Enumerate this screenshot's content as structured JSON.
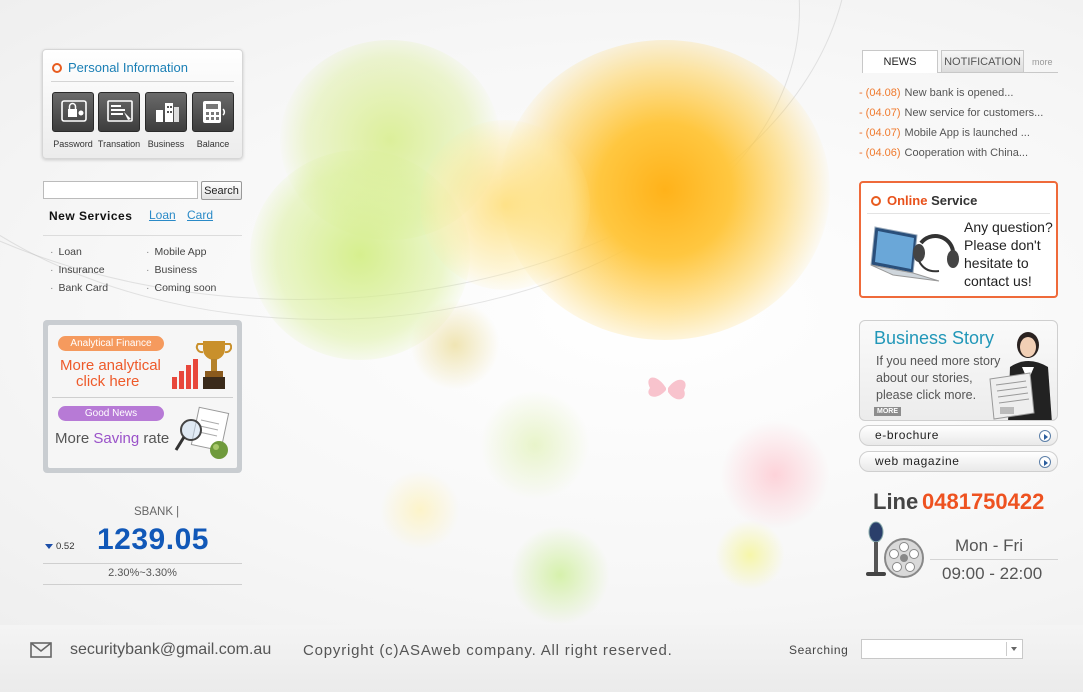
{
  "personal": {
    "title": "Personal Information",
    "buttons": [
      {
        "label": "Password",
        "icon": "password-icon"
      },
      {
        "label": "Transation",
        "icon": "transaction-icon"
      },
      {
        "label": "Business",
        "icon": "business-icon"
      },
      {
        "label": "Balance",
        "icon": "calculator-icon"
      }
    ]
  },
  "search": {
    "value": "",
    "button_label": "Search"
  },
  "services": {
    "heading": "New Services",
    "links": [
      "Loan",
      "Card"
    ],
    "items": [
      "Loan",
      "Mobile App",
      "Insurance",
      "Business",
      "Bank Card",
      "Coming soon"
    ]
  },
  "promo": {
    "analytical": {
      "pill": "Analytical Finance",
      "line1": "More analytical",
      "line2": "click here"
    },
    "good_news": {
      "pill": "Good News",
      "text_before": "More",
      "highlight": "Saving",
      "text_after": "rate"
    }
  },
  "stock": {
    "label": "SBANK  |",
    "change": "0.52",
    "value": "1239.05",
    "range": "2.30%~3.30%"
  },
  "news": {
    "tabs": [
      "NEWS",
      "NOTIFICATION"
    ],
    "more": "more",
    "items": [
      {
        "date": "(04.08)",
        "text": "New bank is  opened..."
      },
      {
        "date": "(04.07)",
        "text": "New service for customers..."
      },
      {
        "date": "(04.07)",
        "text": "Mobile App is launched ..."
      },
      {
        "date": "(04.06)",
        "text": "Cooperation with China..."
      }
    ]
  },
  "online": {
    "title_highlight": "Online",
    "title_rest": "Service",
    "lines": [
      "Any question?",
      "Please don't",
      "hesitate to",
      "contact us!"
    ]
  },
  "story": {
    "title": "Business Story",
    "lines": [
      "If you need more story",
      "about our stories,",
      "please click more."
    ],
    "more": "MORE"
  },
  "links": [
    "e-brochure",
    "web magazine"
  ],
  "contact": {
    "line_label": "Line",
    "line_number": "0481750422",
    "days": "Mon - Fri",
    "hours": "09:00 - 22:00"
  },
  "footer": {
    "email": "securitybank@gmail.com.au",
    "copyright": "Copyright (c)ASAweb company. All right reserved.",
    "search_label": "Searching",
    "select_value": ""
  },
  "colors": {
    "accent_orange": "#ee5220",
    "link_blue": "#2a8ac7",
    "stock_blue": "#1158b8",
    "story_teal": "#2197b8",
    "pill_orange": "#f59a5e",
    "pill_purple": "#b77ad6"
  }
}
